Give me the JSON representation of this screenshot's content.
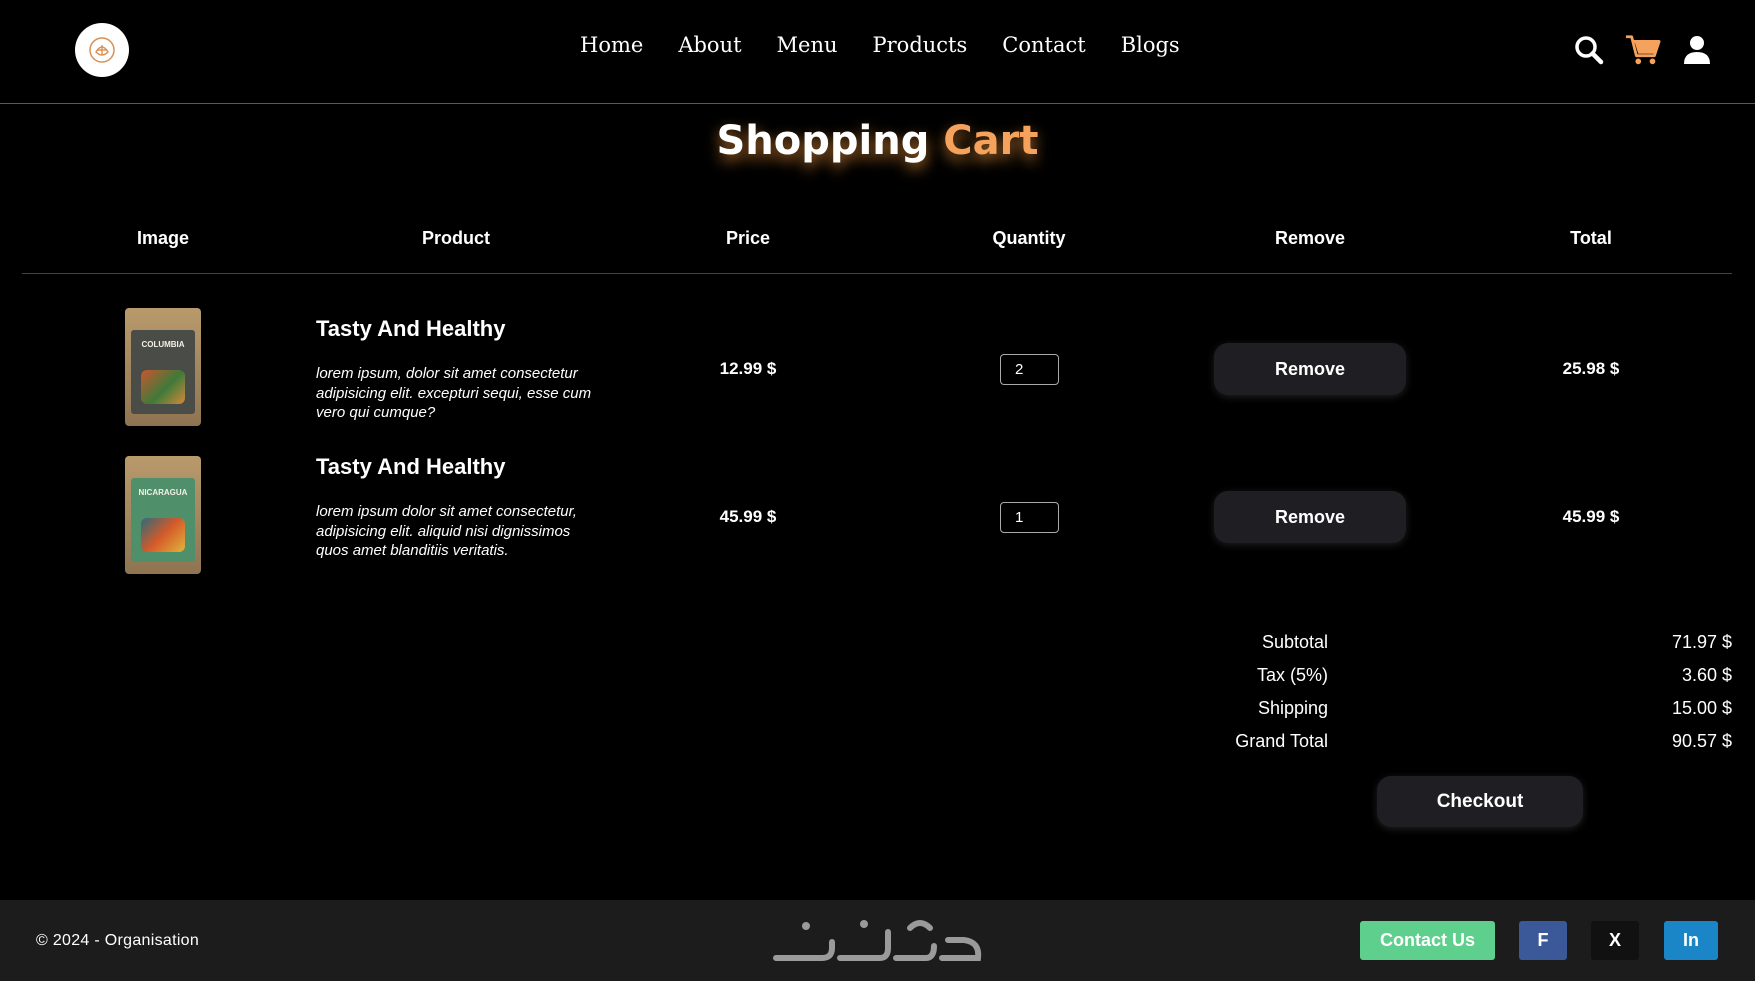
{
  "nav": {
    "items": [
      "Home",
      "About",
      "Menu",
      "Products",
      "Contact",
      "Blogs"
    ]
  },
  "header_icons": [
    "search-icon",
    "cart-icon",
    "user-icon"
  ],
  "title": {
    "first": "Shopping",
    "second": "Cart"
  },
  "table": {
    "headers": [
      "Image",
      "Product",
      "Price",
      "Quantity",
      "Remove",
      "Total"
    ],
    "rows": [
      {
        "image_label": "COLUMBIA",
        "name": "Tasty And Healthy",
        "description": "lorem ipsum, dolor sit amet consectetur adipisicing elit. excepturi sequi, esse cum vero qui cumque?",
        "price": "12.99 $",
        "quantity": "2",
        "remove_label": "Remove",
        "total": "25.98 $"
      },
      {
        "image_label": "NICARAGUA",
        "name": "Tasty And Healthy",
        "description": "lorem ipsum dolor sit amet consectetur, adipisicing elit. aliquid nisi dignissimos quos amet blanditiis veritatis.",
        "price": "45.99 $",
        "quantity": "1",
        "remove_label": "Remove",
        "total": "45.99 $"
      }
    ]
  },
  "summary": [
    {
      "label": "Subtotal",
      "value": "71.97 $"
    },
    {
      "label": "Tax (5%)",
      "value": "3.60 $"
    },
    {
      "label": "Shipping",
      "value": "15.00 $"
    },
    {
      "label": "Grand Total",
      "value": "90.57 $"
    }
  ],
  "checkout_label": "Checkout",
  "footer": {
    "copyright": "© 2024 - Organisation",
    "contact_label": "Contact Us",
    "facebook_label": "F",
    "x_label": "X",
    "linkedin_label": "In"
  },
  "colors": {
    "accent": "#f5a25d",
    "cart_icon": "#f5a25d",
    "button_bg": "#1f1f23",
    "contact": "#5fcf8d",
    "facebook": "#3b5998",
    "x": "#111111",
    "linkedin": "#1b86c7"
  }
}
